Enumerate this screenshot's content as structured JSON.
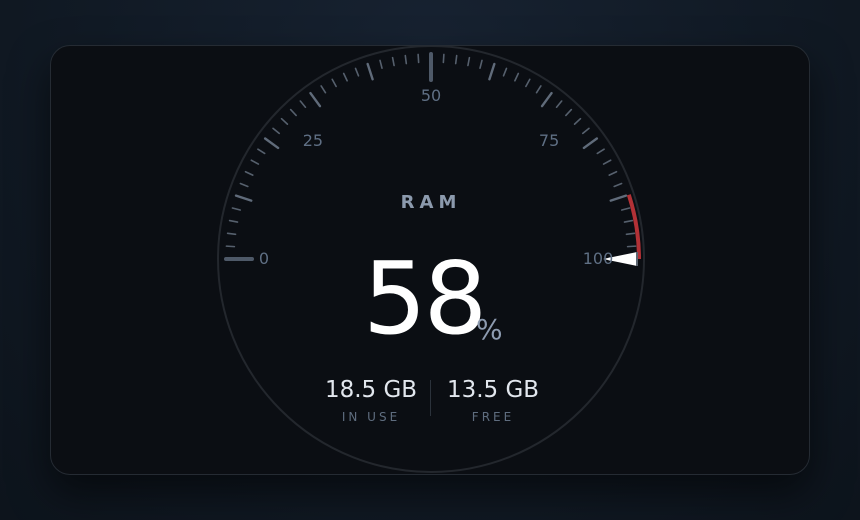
{
  "gauge": {
    "title": "RAM",
    "value": "58",
    "unit": "%",
    "scale_min": 0,
    "scale_max": 100,
    "scale_labels": [
      "0",
      "25",
      "50",
      "75",
      "100"
    ],
    "red_zone_start": 90,
    "red_zone_end": 100,
    "pointer_value": 100
  },
  "stats": {
    "in_use_value": "18.5 GB",
    "in_use_label": "IN USE",
    "free_value": "13.5 GB",
    "free_label": "FREE"
  },
  "colors": {
    "background": "#111a25",
    "card": "#0b0e13",
    "tick": "#6f7c8c",
    "label": "#5f6f84",
    "red_zone": "#b33136",
    "pointer": "#ffffff",
    "primary_text": "#ffffff"
  }
}
